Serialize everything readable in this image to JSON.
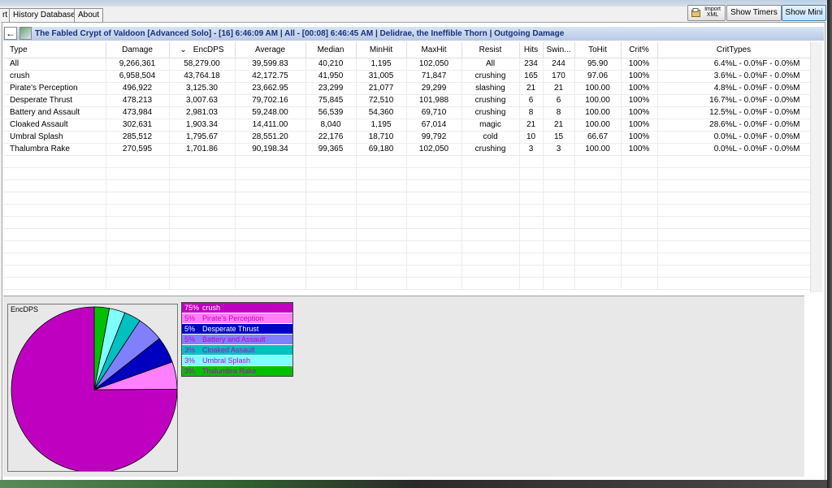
{
  "tabs": [
    "rt",
    "History Database",
    "About"
  ],
  "toolbar": {
    "import_xml_label": "Import XML",
    "show_timers_label": "Show Timers",
    "show_mini_label": "Show Mini"
  },
  "encounter_title": "The Fabled Crypt of Valdoon [Advanced Solo] - [16] 6:46:09 AM  |  All - [00:08] 6:46:45 AM  |  Delidrae, the Ineffible Thorn  |  Outgoing Damage",
  "table": {
    "columns": [
      "Type",
      "Damage",
      "EncDPS",
      "Average",
      "Median",
      "MinHit",
      "MaxHit",
      "Resist",
      "Hits",
      "Swin...",
      "ToHit",
      "Crit%",
      "CritTypes"
    ],
    "sort_indicator": "⌄",
    "rows": [
      [
        "All",
        "9,266,361",
        "58,279.00",
        "39,599.83",
        "40,210",
        "1,195",
        "102,050",
        "All",
        "234",
        "244",
        "95.90",
        "100%",
        "6.4%L - 0.0%F - 0.0%M"
      ],
      [
        "crush",
        "6,958,504",
        "43,764.18",
        "42,172.75",
        "41,950",
        "31,005",
        "71,847",
        "crushing",
        "165",
        "170",
        "97.06",
        "100%",
        "3.6%L - 0.0%F - 0.0%M"
      ],
      [
        "Pirate's Perception",
        "496,922",
        "3,125.30",
        "23,662.95",
        "23,299",
        "21,077",
        "29,299",
        "slashing",
        "21",
        "21",
        "100.00",
        "100%",
        "4.8%L - 0.0%F - 0.0%M"
      ],
      [
        "Desperate Thrust",
        "478,213",
        "3,007.63",
        "79,702.16",
        "75,845",
        "72,510",
        "101,988",
        "crushing",
        "6",
        "6",
        "100.00",
        "100%",
        "16.7%L - 0.0%F - 0.0%M"
      ],
      [
        "Battery and Assault",
        "473,984",
        "2,981.03",
        "59,248.00",
        "56,539",
        "54,360",
        "69,710",
        "crushing",
        "8",
        "8",
        "100.00",
        "100%",
        "12.5%L - 0.0%F - 0.0%M"
      ],
      [
        "Cloaked Assault",
        "302,631",
        "1,903.34",
        "14,411.00",
        "8,040",
        "1,195",
        "67,014",
        "magic",
        "21",
        "21",
        "100.00",
        "100%",
        "28.6%L - 0.0%F - 0.0%M"
      ],
      [
        "Umbral Splash",
        "285,512",
        "1,795.67",
        "28,551.20",
        "22,176",
        "18,710",
        "99,792",
        "cold",
        "10",
        "15",
        "66.67",
        "100%",
        "0.0%L - 0.0%F - 0.0%M"
      ],
      [
        "Thalumbra Rake",
        "270,595",
        "1,701.86",
        "90,198.34",
        "99,365",
        "69,180",
        "102,050",
        "crushing",
        "3",
        "3",
        "100.00",
        "100%",
        "0.0%L - 0.0%F - 0.0%M"
      ]
    ]
  },
  "graph": {
    "label": "EncDPS",
    "chart_data": {
      "type": "pie",
      "categories": [
        "crush",
        "Pirate's Perception",
        "Desperate Thrust",
        "Battery and Assault",
        "Cloaked Assault",
        "Umbral Splash",
        "Thalumbra Rake"
      ],
      "values": [
        43764.18,
        3125.3,
        3007.63,
        2981.03,
        1903.34,
        1795.67,
        1701.86
      ],
      "percent_labels": [
        "75%",
        "5%",
        "5%",
        "5%",
        "3%",
        "3%",
        "3%"
      ],
      "colors": [
        "#c000c0",
        "#ff80ff",
        "#0000c0",
        "#8080ff",
        "#00c0c0",
        "#80ffff",
        "#00c000"
      ],
      "text_colors": [
        "#ffffff",
        "#c000c0",
        "#ffffff",
        "#c000c0",
        "#c000c0",
        "#c000c0",
        "#c000c0"
      ]
    }
  }
}
